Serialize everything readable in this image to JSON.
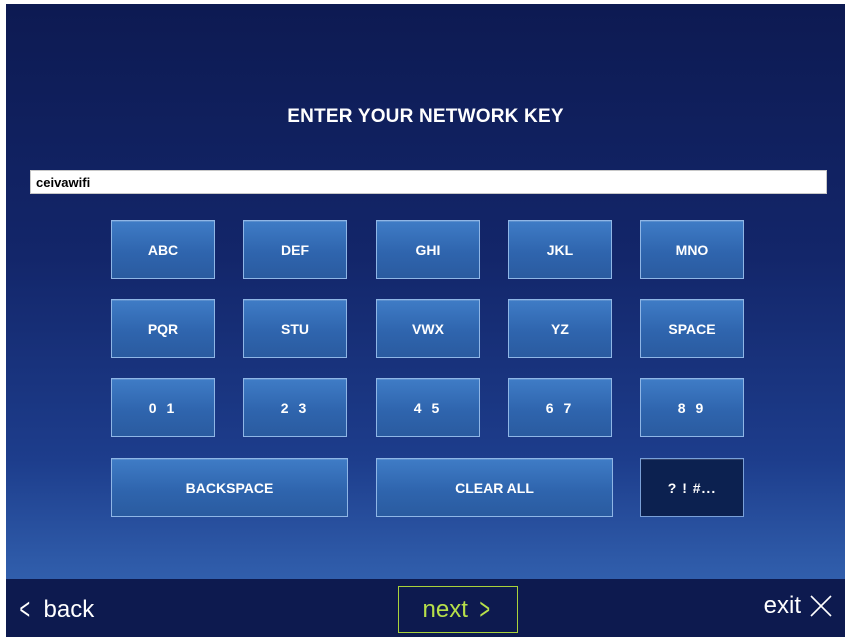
{
  "header": {
    "title": "ENTER YOUR NETWORK KEY"
  },
  "input": {
    "value": "ceivawifi"
  },
  "keys": {
    "abc": "ABC",
    "def": "DEF",
    "ghi": "GHI",
    "jkl": "JKL",
    "mno": "MNO",
    "pqr": "PQR",
    "stu": "STU",
    "vwx": "VWX",
    "yz": "YZ",
    "space": "SPACE",
    "d01": "0 1",
    "d23": "2 3",
    "d45": "4 5",
    "d67": "6 7",
    "d89": "8 9",
    "backspace": "BACKSPACE",
    "clear_all": "CLEAR ALL",
    "symbols": "? ! #..."
  },
  "nav": {
    "back_label": "back",
    "back_icon": "chevron-left-icon",
    "next_label": "next",
    "next_icon": "chevron-right-icon",
    "exit_label": "exit",
    "exit_icon": "close-icon"
  },
  "colors": {
    "background_top": "#0d1a52",
    "key_blue": "#3470b8",
    "symbol_key": "#0c2150",
    "next_accent": "#b7e04a"
  }
}
